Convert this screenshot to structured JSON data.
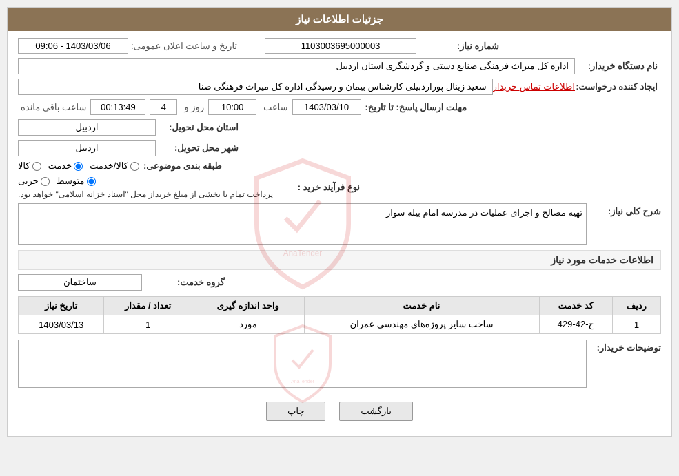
{
  "header": {
    "title": "جزئیات اطلاعات نیاز"
  },
  "fields": {
    "shomareNiaz_label": "شماره نیاز:",
    "shomareNiaz_value": "1103003695000003",
    "namDasgah_label": "نام دستگاه خریدار:",
    "namDasgah_value": "اداره کل میراث فرهنگی  صنایع دستی و گردشگری استان اردبیل",
    "ijadKonande_label": "ایجاد کننده درخواست:",
    "ijadKonande_value": "سعید زینال پوراردبیلی کارشناس بیمان و رسیدگی اداره کل میراث فرهنگی  صنا",
    "ijadKonande_link": "اطلاعات تماس خریدار",
    "mohlatErsalPasokh_label": "مهلت ارسال پاسخ: تا تاریخ:",
    "tarikh_value": "1403/03/10",
    "saat_label": "ساعت",
    "saat_value": "10:00",
    "rooz_label": "روز و",
    "rooz_value": "4",
    "baghimande_label": "ساعت باقی مانده",
    "baghimande_value": "00:13:49",
    "tarikhElanOmomi_label": "تاریخ و ساعت اعلان عمومی:",
    "tarikhElanOmomi_value": "1403/03/06 - 09:06",
    "ostanTahvil_label": "استان محل تحویل:",
    "ostanTahvil_value": "اردبیل",
    "shahrTahvil_label": "شهر محل تحویل:",
    "shahrTahvil_value": "اردبیل",
    "tabgheBandi_label": "طبقه بندی موضوعی:",
    "tabgheBandi_kala": "کالا",
    "tabgheBandi_khadamat": "خدمت",
    "tabgheBandi_kalaKhadamat": "کالا/خدمت",
    "tabgheBandi_selected": "khadamat",
    "noveFaraind_label": "نوع فرآیند خرید :",
    "noveFaraind_jazyi": "جزیی",
    "noveFaraind_motavaset": "متوسط",
    "noveFaraind_note": "پرداخت تمام یا بخشی از مبلغ خریداز محل \"اسناد خزانه اسلامی\" خواهد بود.",
    "noveFaraind_selected": "motavaset"
  },
  "sharhKoliNiaz": {
    "label": "شرح کلی نیاز:",
    "value": "تهیه مصالح و اجرای عملیات در مدرسه امام بیله سوار"
  },
  "khadamatSection": {
    "title": "اطلاعات خدمات مورد نیاز",
    "groohKhadamat_label": "گروه خدمت:",
    "groohKhadamat_value": "ساختمان"
  },
  "table": {
    "headers": [
      "ردیف",
      "کد خدمت",
      "نام خدمت",
      "واحد اندازه گیری",
      "تعداد / مقدار",
      "تاریخ نیاز"
    ],
    "rows": [
      {
        "radif": "1",
        "kodKhadamat": "ج-42-429",
        "namKhadamat": "ساخت سایر پروژه‌های مهندسی عمران",
        "vahed": "مورد",
        "tedad": "1",
        "tarikh": "1403/03/13"
      }
    ]
  },
  "tozihat": {
    "label": "توضیحات خریدار:",
    "value": ""
  },
  "buttons": {
    "chap": "چاپ",
    "bazgasht": "بازگشت"
  }
}
